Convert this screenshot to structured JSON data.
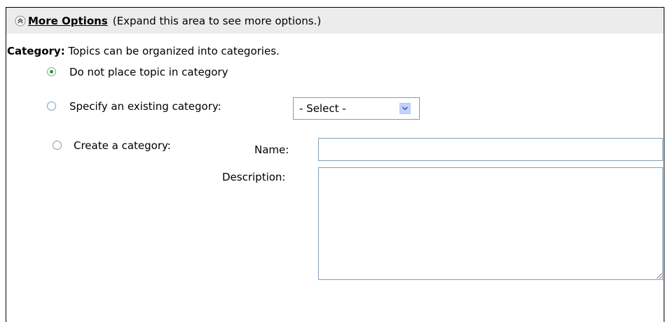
{
  "more_options": {
    "link_label": "More Options",
    "hint": "(Expand this area to see more options.)",
    "icon": "collapse-up-icon"
  },
  "category": {
    "label": "Category:",
    "description": "Topics can be organized into categories.",
    "options": [
      {
        "label": "Do not place topic in category",
        "checked": true
      },
      {
        "label": "Specify an existing category:",
        "checked": false
      },
      {
        "label": "Create a category:",
        "checked": false
      }
    ],
    "select": {
      "value": "- Select -",
      "icon": "chevron-down-icon"
    },
    "create": {
      "name_label": "Name:",
      "name_value": "",
      "description_label": "Description:",
      "description_value": ""
    }
  },
  "colors": {
    "header_bg": "#ececec",
    "radio_selected": "#21a121",
    "input_border": "#7f9db9"
  }
}
